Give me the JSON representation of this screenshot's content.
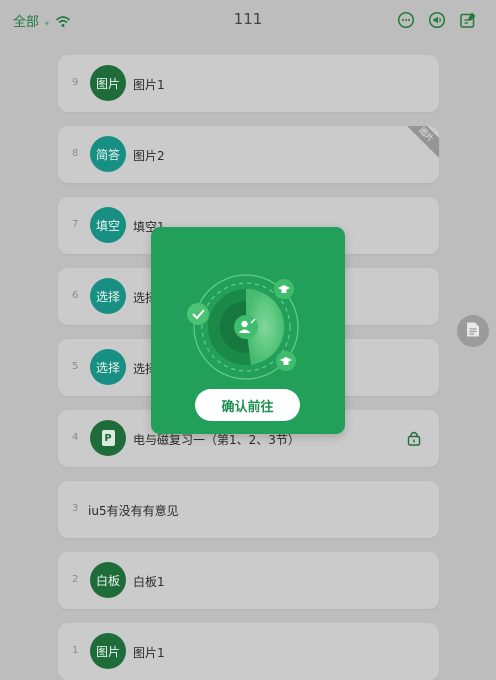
{
  "topbar": {
    "filter_label": "全部",
    "title": "111",
    "icons": [
      "wifi-icon",
      "chat-icon",
      "volume-icon",
      "edit-icon"
    ]
  },
  "list": [
    {
      "index": "9",
      "badge": "图片",
      "name": "图片1"
    },
    {
      "index": "8",
      "badge": "简答",
      "name": "图片2",
      "corner": "图片"
    },
    {
      "index": "7",
      "badge": "填空",
      "name": "填空1"
    },
    {
      "index": "6",
      "badge": "选择",
      "name": "选择"
    },
    {
      "index": "5",
      "badge": "选择",
      "name": "选择"
    },
    {
      "index": "4",
      "badge": "P",
      "name": "电与磁复习一（第1、2、3节）",
      "locked": true
    },
    {
      "index": "3",
      "badge": "",
      "name": "iu5有没有有意见"
    },
    {
      "index": "2",
      "badge": "白板",
      "name": "白板1"
    },
    {
      "index": "1",
      "badge": "图片",
      "name": "图片1"
    }
  ],
  "modal": {
    "confirm_label": "确认前往",
    "icons": [
      "radar-icon",
      "check-icon",
      "graduation-cap-icon",
      "user-icon"
    ]
  },
  "side_button": {
    "icon": "document-icon"
  },
  "colors": {
    "brand_green": "#22a05a",
    "badge_dark": "#1d6c39",
    "badge_teal": "#178f82"
  }
}
